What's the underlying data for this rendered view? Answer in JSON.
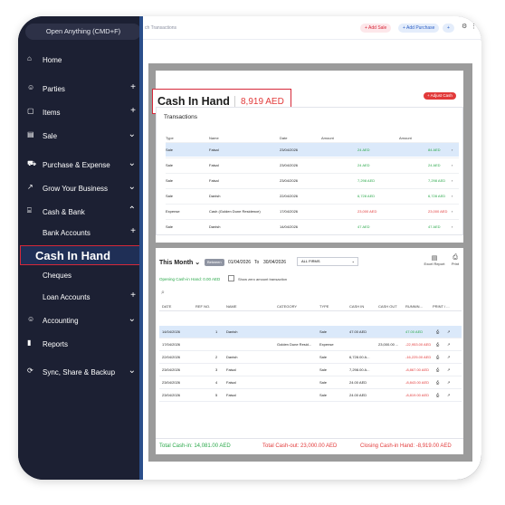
{
  "sidebar": {
    "search": "Open Anything (CMD+F)",
    "items": [
      {
        "label": "Home",
        "icon": "home-icon",
        "trail": ""
      },
      {
        "label": "Parties",
        "icon": "users-icon",
        "trail": "+"
      },
      {
        "label": "Items",
        "icon": "box-icon",
        "trail": "+"
      },
      {
        "label": "Sale",
        "icon": "invoice-icon",
        "trail": "⌄"
      },
      {
        "label": "Purchase & Expense",
        "icon": "cart-icon",
        "trail": "⌄"
      },
      {
        "label": "Grow Your Business",
        "icon": "trend-icon",
        "trail": "⌄"
      },
      {
        "label": "Cash & Bank",
        "icon": "bank-icon",
        "trail": "⌃"
      },
      {
        "label": "Bank Accounts",
        "icon": "",
        "trail": "+"
      },
      {
        "label": "Cash In Hand",
        "icon": "",
        "trail": ""
      },
      {
        "label": "Cheques",
        "icon": "",
        "trail": ""
      },
      {
        "label": "Loan Accounts",
        "icon": "",
        "trail": "+"
      },
      {
        "label": "Accounting",
        "icon": "accounting-icon",
        "trail": "⌄"
      },
      {
        "label": "Reports",
        "icon": "reports-icon",
        "trail": ""
      },
      {
        "label": "Sync, Share & Backup",
        "icon": "sync-icon",
        "trail": "⌄"
      }
    ]
  },
  "topbar": {
    "crumb": "ch Transactions",
    "add_sale": "+ Add Sale",
    "add_purchase": "+ Add Purchase",
    "plus": "+"
  },
  "header": {
    "title": "Cash In Hand",
    "amount": "8,919 AED",
    "adjust_button": "+ Adjust Cash"
  },
  "transactions": {
    "title": "Transactions",
    "columns": [
      "Type",
      "Name",
      "Date",
      "Amount",
      "Amount"
    ],
    "rows": [
      {
        "type": "Sale",
        "name": "Faisal",
        "date": "23/04/2026",
        "amt": "24 AED",
        "amt2": "84 AED",
        "color": "#2aa84a",
        "selected": true
      },
      {
        "type": "Sale",
        "name": "Faisal",
        "date": "23/04/2026",
        "amt": "24 AED",
        "amt2": "24 AED",
        "color": "#2aa84a",
        "selected": false
      },
      {
        "type": "Sale",
        "name": "Faisal",
        "date": "23/04/2026",
        "amt": "7,298 AED",
        "amt2": "7,298 AED",
        "color": "#2aa84a",
        "selected": false
      },
      {
        "type": "Sale",
        "name": "Danish",
        "date": "22/04/2026",
        "amt": "6,728 AED",
        "amt2": "6,728 AED",
        "color": "#2aa84a",
        "selected": false
      },
      {
        "type": "Expense",
        "name": "Cash (Golden Dune Residence)",
        "date": "17/04/2026",
        "amt": "23,000 AED",
        "amt2": "23,000 AED",
        "color": "#e23a3a",
        "selected": false
      },
      {
        "type": "Sale",
        "name": "Danish",
        "date": "14/04/2026",
        "amt": "47 AED",
        "amt2": "47 AED",
        "color": "#2aa84a",
        "selected": false
      }
    ]
  },
  "ledger": {
    "period": "This Month",
    "period_btn": "Between",
    "date_from": "01/04/2026",
    "to_label": "To",
    "date_to": "30/04/2026",
    "firm": "ALL FIRMS",
    "excel": "Excel Report",
    "print": "Print",
    "opening": "Opening Cash-in Hand: 0.00 AED",
    "zero_label": "Show zero amount transaction",
    "columns": [
      "DATE",
      "REF NO.",
      "NAME",
      "CATEGORY",
      "TYPE",
      "CASH IN",
      "CASH OUT",
      "RUNNIN...",
      "PRINT / ..."
    ],
    "rows": [
      {
        "date": "14/04/2026",
        "ref": "1",
        "name": "Danish",
        "cat": "",
        "type": "Sale",
        "cin": "47.00 AED",
        "cout": "",
        "run": "47.00 AED",
        "runcolor": "#2aa84a",
        "selected": true
      },
      {
        "date": "17/04/2026",
        "ref": "",
        "name": "",
        "cat": "Golden Dune Resid...",
        "type": "Expense",
        "cin": "",
        "cout": "23,000.00 ...",
        "run": "-22,953.00 AED",
        "runcolor": "#e23a3a",
        "selected": false
      },
      {
        "date": "22/04/2026",
        "ref": "2",
        "name": "Danish",
        "cat": "",
        "type": "Sale",
        "cin": "6,728.00 A...",
        "cout": "",
        "run": "-16,225.00 AED",
        "runcolor": "#e23a3a",
        "selected": false
      },
      {
        "date": "23/04/2026",
        "ref": "3",
        "name": "Faisal",
        "cat": "",
        "type": "Sale",
        "cin": "7,298.00 A...",
        "cout": "",
        "run": "-8,867.00 AED",
        "runcolor": "#e23a3a",
        "selected": false
      },
      {
        "date": "23/04/2026",
        "ref": "4",
        "name": "Faisal",
        "cat": "",
        "type": "Sale",
        "cin": "24.00 AED",
        "cout": "",
        "run": "-8,843.00 AED",
        "runcolor": "#e23a3a",
        "selected": false
      },
      {
        "date": "23/04/2026",
        "ref": "5",
        "name": "Faisal",
        "cat": "",
        "type": "Sale",
        "cin": "24.00 AED",
        "cout": "",
        "run": "-8,819.00 AED",
        "runcolor": "#e23a3a",
        "selected": false
      }
    ]
  },
  "footer": {
    "cash_in": "Total Cash-in: 14,081.00 AED",
    "cash_out": "Total Cash-out: 23,000.00 AED",
    "closing": "Closing Cash-in Hand: -8,919.00 AED"
  },
  "colors": {
    "sidebar": "#1c2033",
    "accent_red": "#d62839",
    "green": "#2aa84a",
    "red": "#e23a3a",
    "selected_row": "#dbe9fa"
  }
}
